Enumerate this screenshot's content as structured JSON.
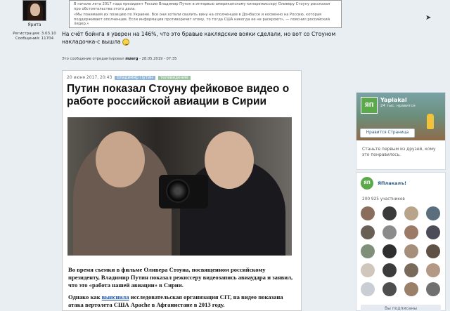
{
  "user": {
    "name": "Ярита",
    "registration_label": "Регистрация: 3.03.10",
    "messages_label": "Сообщений: 11704"
  },
  "post": {
    "quote_p1": "В начале лета 2017 года президент России Владимир Путин в интервью американскому кинорежиссеру Оливеру Стоуну рассказал про обстоятельства этого дела.",
    "quote_p2": "«Мы понимаем их позицию по Украине. Все они хотели свалить вину на ополченцев в Донбассе и косвенно на Россию, которая поддерживает ополченцев. Если информация противоречит этому, то тогда США никогда ее не раскроют», — пояснил российский лидер.»",
    "text": "На счёт бойнга я уверен на 146%, что это бравые каклядские вояки сделали, но вот со Стоуном накладочка-с вышла",
    "edited_prefix": "Это сообщение отредактировал",
    "edited_user": "mzerg",
    "edited_suffix": "- 28.05.2019 - 07:35"
  },
  "article": {
    "date": "20 июня 2017, 20:43",
    "tag1": "Владимир Путин",
    "tag2": "телевидение",
    "title": "Путин показал Стоуну фейковое видео о работе российской авиации в Сирии",
    "para1": "Во время съемки в фильме Оливера Стоуна, посвященном российскому президенту, Владимир Путин показал режиссеру видеозапись авиаудара и заявил, что это «работа нашей авиации» в Сирии.",
    "para2_before": "Однако как ",
    "para2_link": "выяснила",
    "para2_after": " исследовательская организация CIT, на видео показана атака вертолета США Apache в Афганистане в 2013 году."
  },
  "widget_yaplakal": {
    "logo": "ЯП",
    "name": "Yaplakal",
    "subtitle": "24 тыс. нравится",
    "like_button": "Нравится Страница",
    "friends_text": "Станьте первым из друзей, кому это понравилось."
  },
  "widget_vk": {
    "logo": "ЯП",
    "name": "ЯПлакалъ!",
    "members": "200 925 участников",
    "subscribe_button": "Вы подписаны"
  }
}
